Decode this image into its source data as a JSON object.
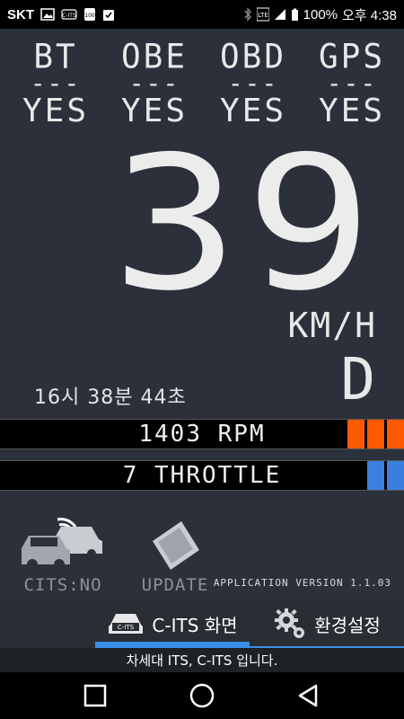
{
  "statusbar": {
    "carrier": "SKT",
    "battery": "100%",
    "time": "오후 4:38",
    "icons": [
      "image-icon",
      "cits-icon",
      "sim-icon",
      "download-icon",
      "bluetooth-icon",
      "wifi-icon",
      "signal-icon",
      "battery-icon"
    ]
  },
  "status": [
    {
      "name": "BT",
      "dash": "---",
      "value": "YES"
    },
    {
      "name": "OBE",
      "dash": "---",
      "value": "YES"
    },
    {
      "name": "OBD",
      "dash": "---",
      "value": "YES"
    },
    {
      "name": "GPS",
      "dash": "---",
      "value": "YES"
    }
  ],
  "speed": "39",
  "unit": "KM/H",
  "gear": "D",
  "time_display": "16시 38분 44초",
  "rpm": {
    "text": "1403 RPM",
    "color": "#ff5a00",
    "filled_cells": 3
  },
  "throttle": {
    "text": "7 THROTTLE",
    "color": "#3a7fe0",
    "filled_cells": 2
  },
  "bottom": {
    "cits_label": "CITS:NO",
    "update_label": "UPDATE",
    "version": "APPLICATION VERSION 1.1.03"
  },
  "tabs": [
    {
      "label": "C-ITS 화면",
      "icon": "car-icon",
      "badge": "C-ITS",
      "active": true
    },
    {
      "label": "환경설정",
      "icon": "gear-icon",
      "active": false
    }
  ],
  "footer": "차세대 ITS, C-ITS 입니다.",
  "colors": {
    "accent": "#3a8ee6",
    "rpm": "#ff5a00",
    "throttle": "#3a7fe0"
  }
}
